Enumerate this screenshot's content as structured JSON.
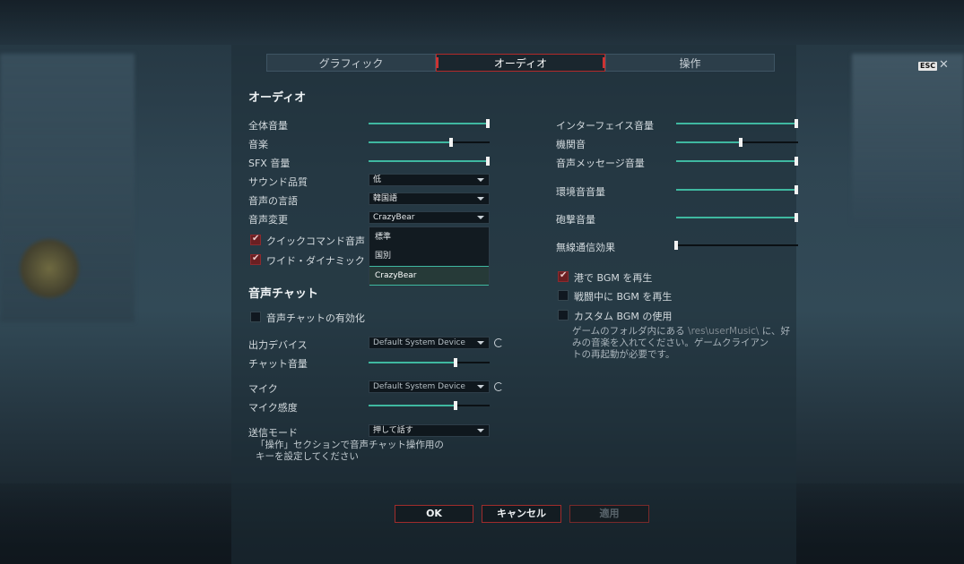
{
  "tabs": [
    {
      "label": "グラフィック",
      "active": false
    },
    {
      "label": "オーディオ",
      "active": true
    },
    {
      "label": "操作",
      "active": false
    }
  ],
  "esc_label": "ESC",
  "close_glyph": "✕",
  "audio": {
    "title": "オーディオ",
    "master_volume": {
      "label": "全体音量",
      "value": 1.0
    },
    "music": {
      "label": "音楽",
      "value": 0.68
    },
    "sfx_volume": {
      "label": "SFX 音量",
      "value": 1.0
    },
    "sound_quality": {
      "label": "サウンド品質",
      "value": "低"
    },
    "voice_language": {
      "label": "音声の言語",
      "value": "韓国語"
    },
    "voice_change": {
      "label": "音声変更",
      "value": "CrazyBear",
      "options": [
        "標準",
        "国別",
        "CrazyBear"
      ],
      "selected_option": "CrazyBear"
    },
    "quick_command_voice": {
      "label": "クイックコマンド音声",
      "checked": true
    },
    "wide_dynamic": {
      "label": "ワイド・ダイナミック",
      "checked": true
    },
    "interface_volume": {
      "label": "インターフェイス音量",
      "value": 1.0
    },
    "engine_sound": {
      "label": "機関音",
      "value": 0.53
    },
    "voice_message_volume": {
      "label": "音声メッセージ音量",
      "value": 1.0
    },
    "ambient_volume": {
      "label": "環境音音量",
      "value": 1.0
    },
    "gunfire_volume": {
      "label": "砲撃音量",
      "value": 1.0
    },
    "radio_effect": {
      "label": "無線通信効果",
      "value": 0.0
    },
    "port_bgm": {
      "label": "港で BGM を再生",
      "checked": true
    },
    "battle_bgm": {
      "label": "戦闘中に BGM を再生",
      "checked": false
    },
    "custom_bgm": {
      "label": "カスタム BGM の使用",
      "checked": false
    },
    "custom_bgm_note": {
      "line1_before": "ゲームのフォルダ内にある ",
      "path": "\\res\\userMusic\\",
      "line1_after": " に、好",
      "line2": "みの音楽を入れてください。ゲームクライアン",
      "line3": "トの再起動が必要です。"
    }
  },
  "voice_chat": {
    "title": "音声チャット",
    "enable": {
      "label": "音声チャットの有効化",
      "checked": false
    },
    "output_device": {
      "label": "出力デバイス",
      "value": "Default System Device"
    },
    "chat_volume": {
      "label": "チャット音量",
      "value": 0.72
    },
    "mic": {
      "label": "マイク",
      "value": "Default System Device"
    },
    "mic_sensitivity": {
      "label": "マイク感度",
      "value": 0.72
    },
    "transmit_mode": {
      "label": "送信モード",
      "value": "押して話す"
    },
    "transmit_note": {
      "line1": "「操作」セクションで音声チャット操作用の",
      "line2": "キーを設定してください"
    }
  },
  "buttons": {
    "ok": "OK",
    "cancel": "キャンセル",
    "apply": "適用"
  },
  "colors": {
    "accent": "#3fb8a0",
    "border_red": "#a12c2c"
  }
}
